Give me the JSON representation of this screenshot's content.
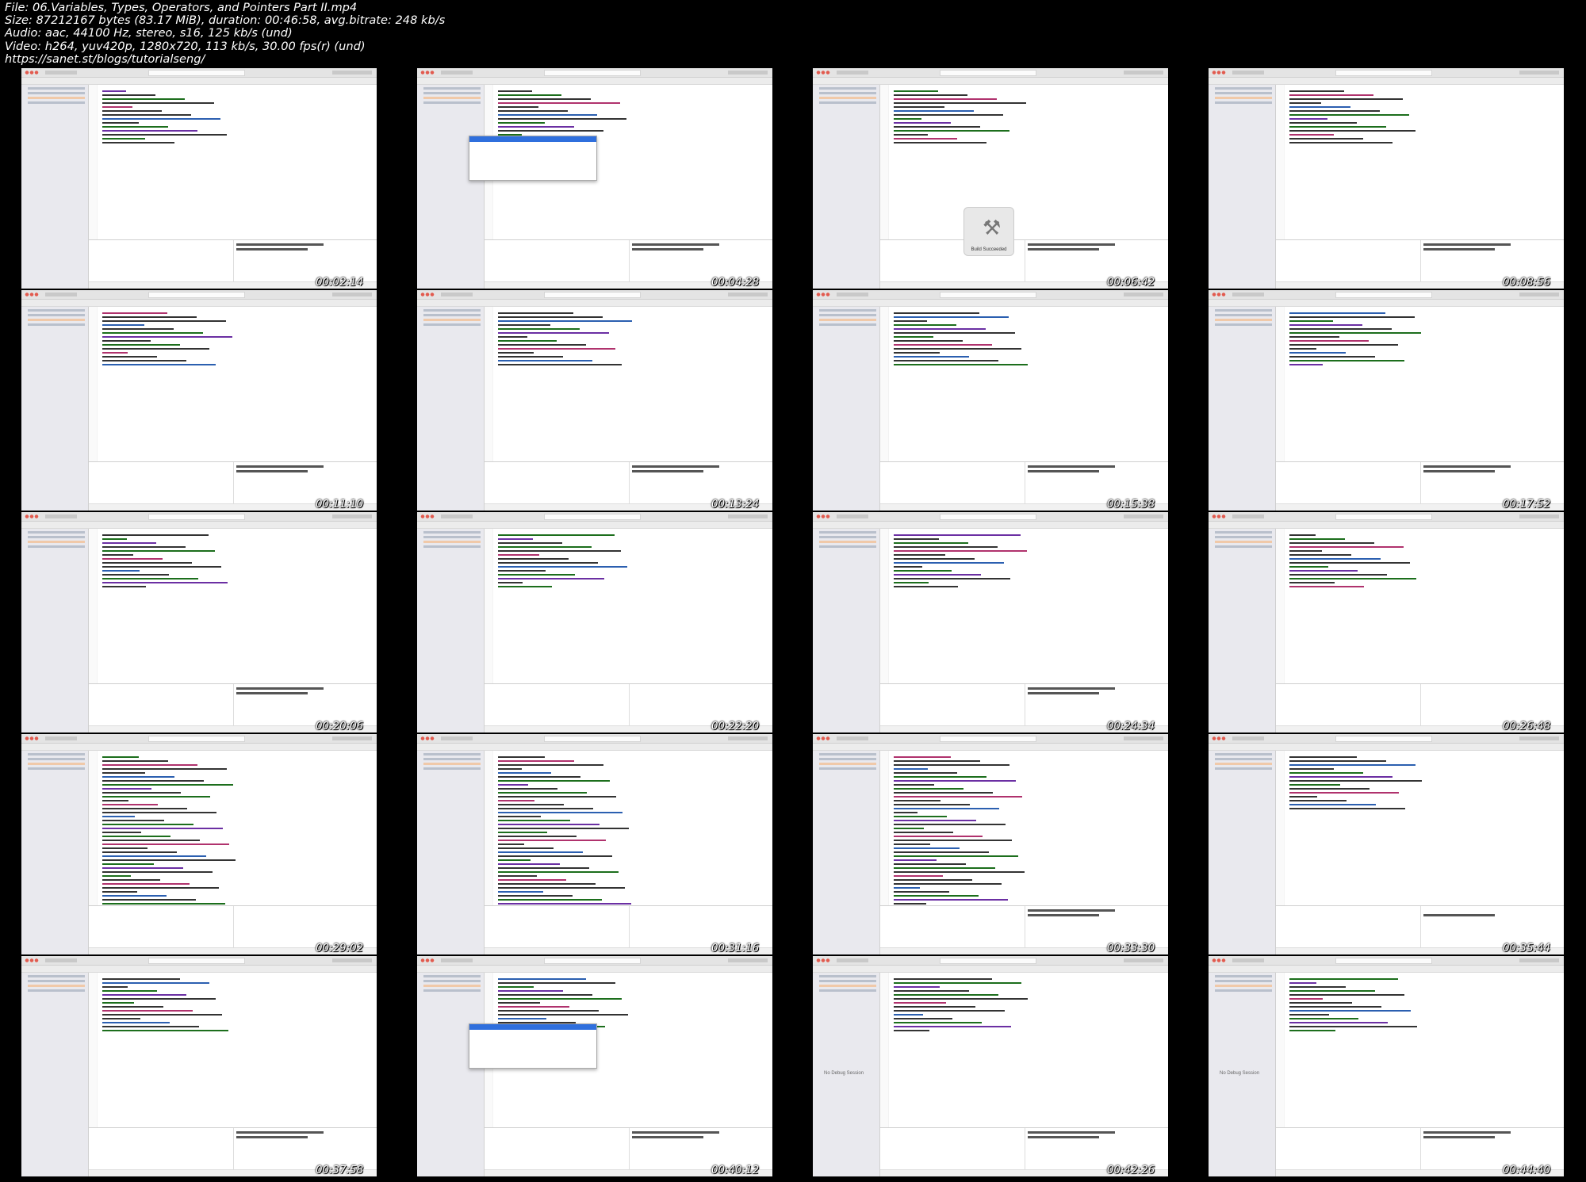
{
  "file_info": {
    "file": "File: 06.Variables, Types, Operators, and Pointers Part II.mp4",
    "size": "Size: 87212167 bytes (83.17 MiB), duration: 00:46:58, avg.bitrate: 248 kb/s",
    "audio": "Audio: aac, 44100 Hz, stereo, s16, 125 kb/s (und)",
    "video": "Video: h264, yuv420p, 1280x720, 113 kb/s, 30.00 fps(r) (und)",
    "url": "https://sanet.st/blogs/tutorialseng/"
  },
  "thumbnails": [
    {
      "time": "00:02:14",
      "variant": "normal",
      "out1": "10",
      "out2": "Program ended with exit code: 0"
    },
    {
      "time": "00:04:28",
      "variant": "popup",
      "out1": "Hello",
      "out2": "Program ended with exit code: 0"
    },
    {
      "time": "00:06:42",
      "variant": "build",
      "overlay": "Build Succeeded",
      "out1": "1",
      "out2": "10"
    },
    {
      "time": "00:08:56",
      "variant": "normal",
      "out1": "2000000000",
      "out2": "Program ended with exit code: 0"
    },
    {
      "time": "00:11:10",
      "variant": "normal",
      "out1": "24",
      "out2": "Program ended with exit code: 0"
    },
    {
      "time": "00:13:24",
      "variant": "normal",
      "out1": "42949672",
      "out2": "Program ended with exit code: 0"
    },
    {
      "time": "00:15:38",
      "variant": "normal",
      "out1": "-1794967296 2000000000",
      "out2": "Program ended with exit code: 0"
    },
    {
      "time": "00:17:52",
      "variant": "normal",
      "out1": "-1794967296 2000000000",
      "out2": "Program ended with exit code: 0"
    },
    {
      "time": "00:20:06",
      "variant": "normal",
      "out1": "4",
      "out2": "Program ended with exit code: 0"
    },
    {
      "time": "00:22:20",
      "variant": "normal",
      "out1": "",
      "out2": ""
    },
    {
      "time": "00:24:34",
      "variant": "error",
      "out1": "Name: Foo",
      "out2": "Program ended with exit code: 0"
    },
    {
      "time": "00:26:48",
      "variant": "normal",
      "out1": "",
      "out2": ""
    },
    {
      "time": "00:29:02",
      "variant": "long",
      "out1": "",
      "out2": ""
    },
    {
      "time": "00:31:16",
      "variant": "long",
      "out1": "",
      "out2": ""
    },
    {
      "time": "00:33:30",
      "variant": "long",
      "out1": "Name: Richard Anderson",
      "out2": "Grade: 9.250000"
    },
    {
      "time": "00:35:44",
      "variant": "normal",
      "out1": "",
      "out2": "Program ended with exit code: 0"
    },
    {
      "time": "00:37:58",
      "variant": "normal",
      "out1": "1 2 3",
      "out2": "Program ended with exit code: 0"
    },
    {
      "time": "00:40:12",
      "variant": "popup2",
      "out1": "1 2 3",
      "out2": "Program ended with exit code: 0"
    },
    {
      "time": "00:42:26",
      "variant": "nodebug",
      "overlay": "No Debug Session",
      "out1": "1 2 3 4",
      "out2": "Program ended with exit code: 0"
    },
    {
      "time": "00:44:40",
      "variant": "nodebug",
      "overlay": "No Debug Session",
      "out1": "11",
      "out2": "Program ended with exit code: 0"
    }
  ]
}
